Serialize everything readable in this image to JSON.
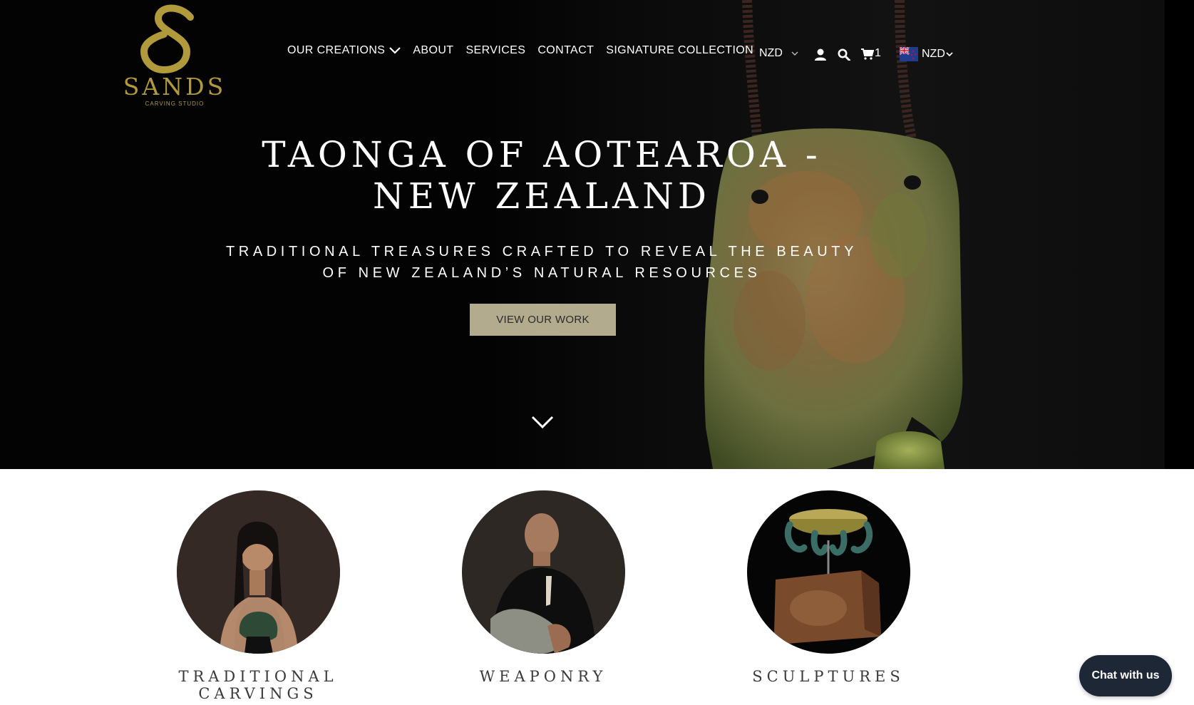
{
  "brand": {
    "logo_name": "SANDS",
    "logo_sub": "CARVING STUDIO"
  },
  "nav": {
    "items": [
      {
        "label": "OUR CREATIONS",
        "has_dropdown": true
      },
      {
        "label": "ABOUT"
      },
      {
        "label": "SERVICES"
      },
      {
        "label": "CONTACT"
      },
      {
        "label": "SIGNATURE COLLECTION"
      }
    ]
  },
  "utility": {
    "currency": "NZD",
    "cart_count": "1",
    "flag_currency": "NZD",
    "icons": [
      "user-icon",
      "search-icon",
      "cart-icon"
    ]
  },
  "hero": {
    "title": "TAONGA OF AOTEAROA - NEW ZEALAND",
    "subtitle": "TRADITIONAL TREASURES CRAFTED TO REVEAL THE BEAUTY OF NEW ZEALAND’S NATURAL RESOURCES",
    "cta": "VIEW OUR WORK"
  },
  "categories": [
    {
      "label": "TRADITIONAL CARVINGS"
    },
    {
      "label": "WEAPONRY"
    },
    {
      "label": "SCULPTURES"
    }
  ],
  "chat": {
    "label": "Chat with us"
  },
  "colors": {
    "gold": "#b09a3b",
    "cta_bg": "#b3ab8d",
    "chat_bg": "#1d2736",
    "hero_bg": "#030303"
  }
}
